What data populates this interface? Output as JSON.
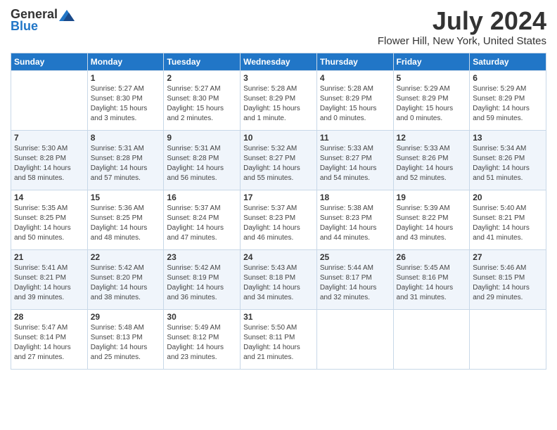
{
  "logo": {
    "general": "General",
    "blue": "Blue"
  },
  "title": "July 2024",
  "location": "Flower Hill, New York, United States",
  "days_of_week": [
    "Sunday",
    "Monday",
    "Tuesday",
    "Wednesday",
    "Thursday",
    "Friday",
    "Saturday"
  ],
  "weeks": [
    [
      {
        "day": "",
        "info": ""
      },
      {
        "day": "1",
        "info": "Sunrise: 5:27 AM\nSunset: 8:30 PM\nDaylight: 15 hours\nand 3 minutes."
      },
      {
        "day": "2",
        "info": "Sunrise: 5:27 AM\nSunset: 8:30 PM\nDaylight: 15 hours\nand 2 minutes."
      },
      {
        "day": "3",
        "info": "Sunrise: 5:28 AM\nSunset: 8:29 PM\nDaylight: 15 hours\nand 1 minute."
      },
      {
        "day": "4",
        "info": "Sunrise: 5:28 AM\nSunset: 8:29 PM\nDaylight: 15 hours\nand 0 minutes."
      },
      {
        "day": "5",
        "info": "Sunrise: 5:29 AM\nSunset: 8:29 PM\nDaylight: 15 hours\nand 0 minutes."
      },
      {
        "day": "6",
        "info": "Sunrise: 5:29 AM\nSunset: 8:29 PM\nDaylight: 14 hours\nand 59 minutes."
      }
    ],
    [
      {
        "day": "7",
        "info": "Sunrise: 5:30 AM\nSunset: 8:28 PM\nDaylight: 14 hours\nand 58 minutes."
      },
      {
        "day": "8",
        "info": "Sunrise: 5:31 AM\nSunset: 8:28 PM\nDaylight: 14 hours\nand 57 minutes."
      },
      {
        "day": "9",
        "info": "Sunrise: 5:31 AM\nSunset: 8:28 PM\nDaylight: 14 hours\nand 56 minutes."
      },
      {
        "day": "10",
        "info": "Sunrise: 5:32 AM\nSunset: 8:27 PM\nDaylight: 14 hours\nand 55 minutes."
      },
      {
        "day": "11",
        "info": "Sunrise: 5:33 AM\nSunset: 8:27 PM\nDaylight: 14 hours\nand 54 minutes."
      },
      {
        "day": "12",
        "info": "Sunrise: 5:33 AM\nSunset: 8:26 PM\nDaylight: 14 hours\nand 52 minutes."
      },
      {
        "day": "13",
        "info": "Sunrise: 5:34 AM\nSunset: 8:26 PM\nDaylight: 14 hours\nand 51 minutes."
      }
    ],
    [
      {
        "day": "14",
        "info": "Sunrise: 5:35 AM\nSunset: 8:25 PM\nDaylight: 14 hours\nand 50 minutes."
      },
      {
        "day": "15",
        "info": "Sunrise: 5:36 AM\nSunset: 8:25 PM\nDaylight: 14 hours\nand 48 minutes."
      },
      {
        "day": "16",
        "info": "Sunrise: 5:37 AM\nSunset: 8:24 PM\nDaylight: 14 hours\nand 47 minutes."
      },
      {
        "day": "17",
        "info": "Sunrise: 5:37 AM\nSunset: 8:23 PM\nDaylight: 14 hours\nand 46 minutes."
      },
      {
        "day": "18",
        "info": "Sunrise: 5:38 AM\nSunset: 8:23 PM\nDaylight: 14 hours\nand 44 minutes."
      },
      {
        "day": "19",
        "info": "Sunrise: 5:39 AM\nSunset: 8:22 PM\nDaylight: 14 hours\nand 43 minutes."
      },
      {
        "day": "20",
        "info": "Sunrise: 5:40 AM\nSunset: 8:21 PM\nDaylight: 14 hours\nand 41 minutes."
      }
    ],
    [
      {
        "day": "21",
        "info": "Sunrise: 5:41 AM\nSunset: 8:21 PM\nDaylight: 14 hours\nand 39 minutes."
      },
      {
        "day": "22",
        "info": "Sunrise: 5:42 AM\nSunset: 8:20 PM\nDaylight: 14 hours\nand 38 minutes."
      },
      {
        "day": "23",
        "info": "Sunrise: 5:42 AM\nSunset: 8:19 PM\nDaylight: 14 hours\nand 36 minutes."
      },
      {
        "day": "24",
        "info": "Sunrise: 5:43 AM\nSunset: 8:18 PM\nDaylight: 14 hours\nand 34 minutes."
      },
      {
        "day": "25",
        "info": "Sunrise: 5:44 AM\nSunset: 8:17 PM\nDaylight: 14 hours\nand 32 minutes."
      },
      {
        "day": "26",
        "info": "Sunrise: 5:45 AM\nSunset: 8:16 PM\nDaylight: 14 hours\nand 31 minutes."
      },
      {
        "day": "27",
        "info": "Sunrise: 5:46 AM\nSunset: 8:15 PM\nDaylight: 14 hours\nand 29 minutes."
      }
    ],
    [
      {
        "day": "28",
        "info": "Sunrise: 5:47 AM\nSunset: 8:14 PM\nDaylight: 14 hours\nand 27 minutes."
      },
      {
        "day": "29",
        "info": "Sunrise: 5:48 AM\nSunset: 8:13 PM\nDaylight: 14 hours\nand 25 minutes."
      },
      {
        "day": "30",
        "info": "Sunrise: 5:49 AM\nSunset: 8:12 PM\nDaylight: 14 hours\nand 23 minutes."
      },
      {
        "day": "31",
        "info": "Sunrise: 5:50 AM\nSunset: 8:11 PM\nDaylight: 14 hours\nand 21 minutes."
      },
      {
        "day": "",
        "info": ""
      },
      {
        "day": "",
        "info": ""
      },
      {
        "day": "",
        "info": ""
      }
    ]
  ]
}
